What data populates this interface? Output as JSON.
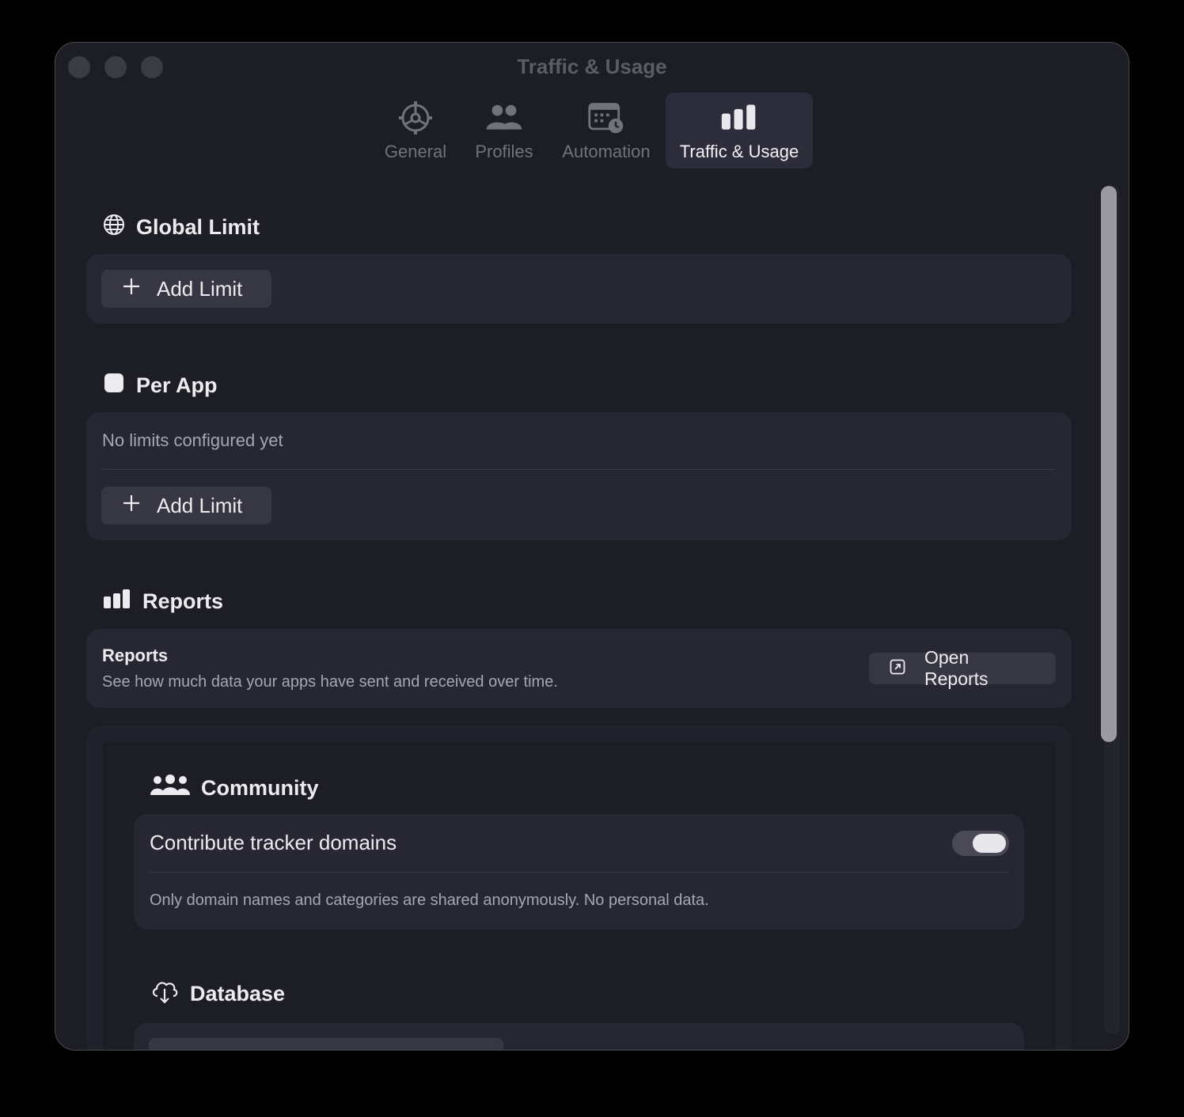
{
  "window": {
    "title": "Traffic & Usage"
  },
  "tabs": [
    {
      "label": "General",
      "icon": "gear-icon",
      "active": false
    },
    {
      "label": "Profiles",
      "icon": "people-icon",
      "active": false
    },
    {
      "label": "Automation",
      "icon": "calendar-clock-icon",
      "active": false
    },
    {
      "label": "Traffic & Usage",
      "icon": "bar-chart-icon",
      "active": true
    }
  ],
  "global_limit": {
    "title": "Global Limit",
    "icon": "globe-icon",
    "add_label": "Add Limit"
  },
  "per_app": {
    "title": "Per App",
    "icon": "app-square-icon",
    "empty_text": "No limits configured yet",
    "add_label": "Add Limit"
  },
  "reports": {
    "title": "Reports",
    "icon": "bar-chart-icon",
    "row_title": "Reports",
    "row_description": "See how much data your apps have sent and received over time.",
    "open_label": "Open Reports"
  },
  "community": {
    "title": "Community",
    "icon": "group-icon",
    "toggle_label": "Contribute tracker domains",
    "toggle_on": true,
    "note": "Only domain names and categories are shared anonymously. No personal data."
  },
  "database": {
    "title": "Database",
    "icon": "cloud-download-icon"
  },
  "colors": {
    "background": "#000000",
    "window": "#1d1d26",
    "card": "#272734",
    "button": "#373744",
    "active_tab": "#2c2c3a"
  }
}
